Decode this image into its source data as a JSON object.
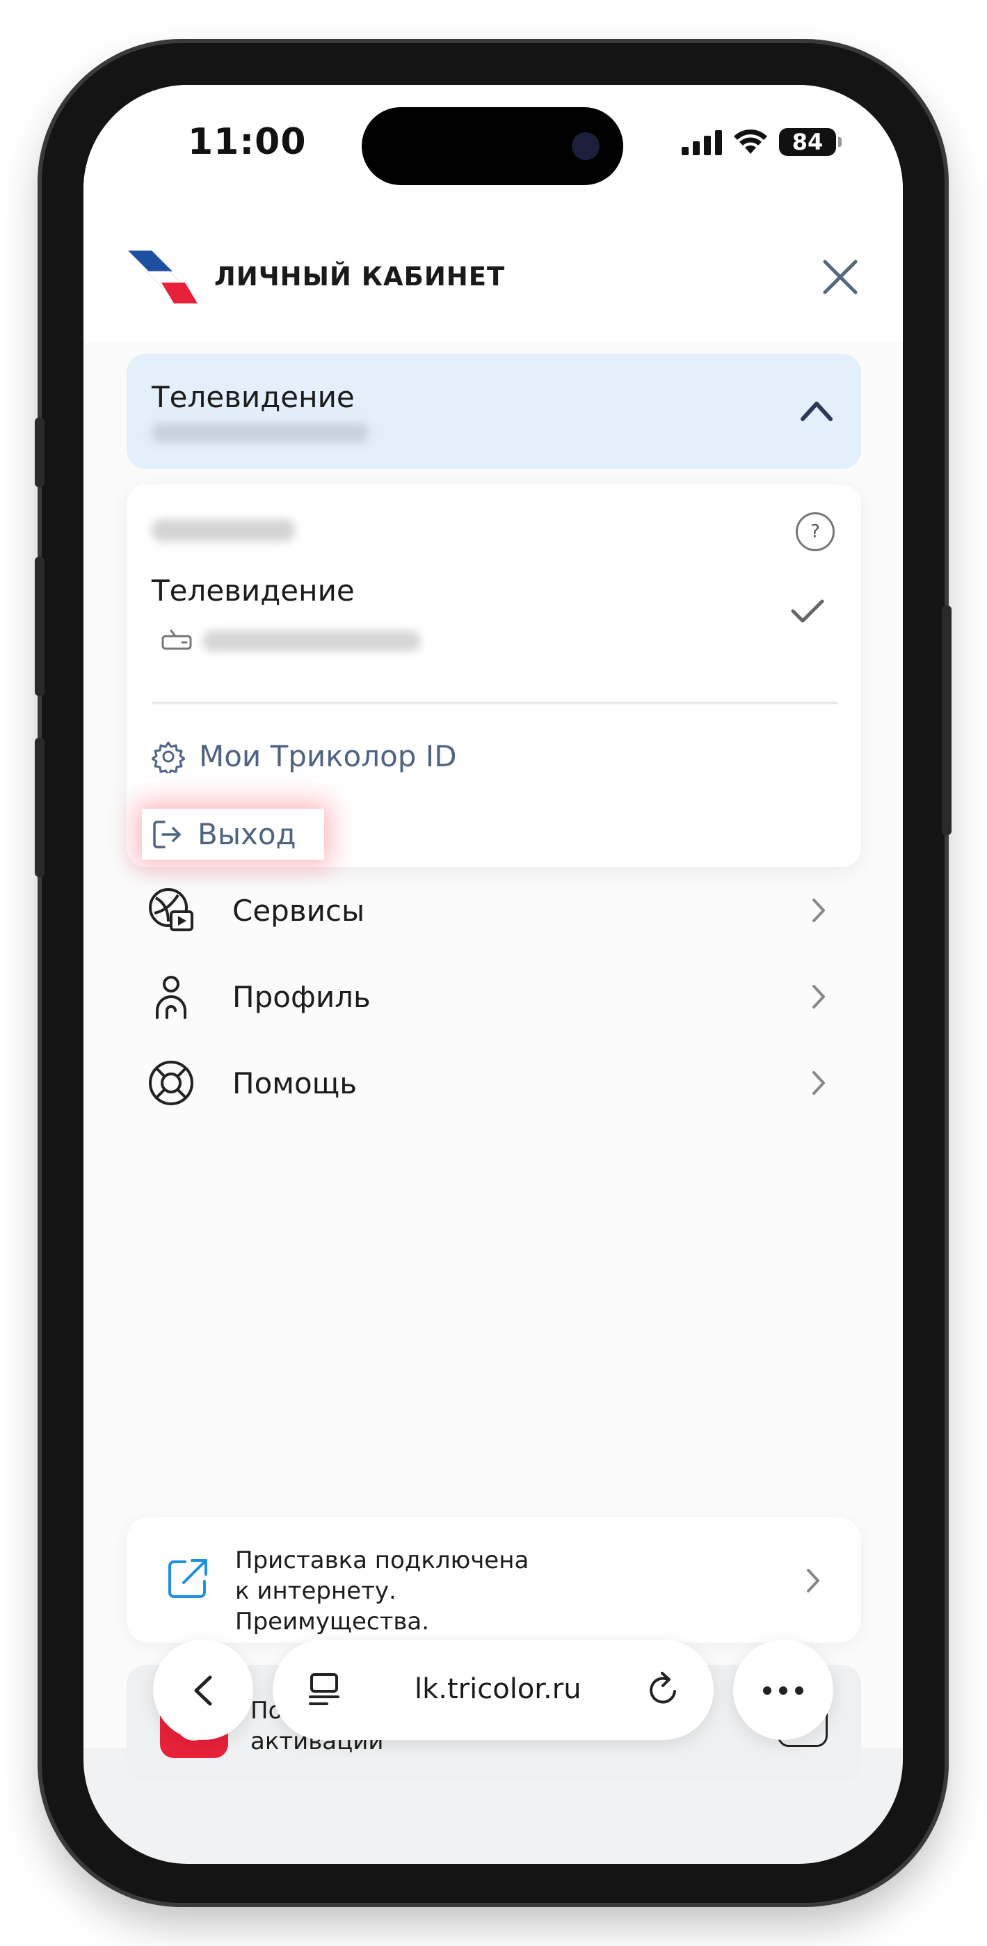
{
  "status_bar": {
    "time": "11:00",
    "battery": "84"
  },
  "header": {
    "title": "ЛИЧНЫЙ КАБИНЕТ"
  },
  "account_selector": {
    "title": "Телевидение"
  },
  "dropdown": {
    "service_title": "Телевидение",
    "menu": {
      "tricolor_id": "Мои Триколор ID",
      "logout": "Выход"
    },
    "help": "?"
  },
  "nav": [
    {
      "label": "Сервисы",
      "icon": "services-icon"
    },
    {
      "label": "Профиль",
      "icon": "profile-icon"
    },
    {
      "label": "Помощь",
      "icon": "lifebuoy-icon"
    }
  ],
  "promo": {
    "line1": "Приставка подключена",
    "line2": "к интернету.",
    "line3": "Преимущества."
  },
  "activation": {
    "line1": "Повтор команд",
    "line2": "активации",
    "help": "?"
  },
  "browser": {
    "url": "lk.tricolor.ru"
  },
  "colors": {
    "accent_red": "#E8213A",
    "brand_blue": "#1F4FA0",
    "selector_bg": "#E3EFFB",
    "menu_text": "#4F6482"
  }
}
